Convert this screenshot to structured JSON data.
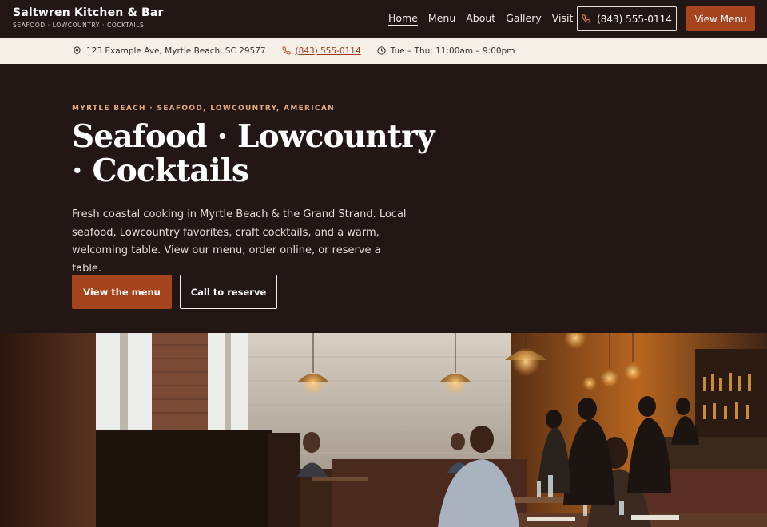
{
  "header": {
    "brand_name": "Saltwren Kitchen & Bar",
    "brand_tagline": "SEAFOOD · LOWCOUNTRY · COCKTAILS",
    "nav": [
      {
        "label": "Home",
        "active": true
      },
      {
        "label": "Menu",
        "active": false
      },
      {
        "label": "About",
        "active": false
      },
      {
        "label": "Gallery",
        "active": false
      },
      {
        "label": "Visit",
        "active": false
      }
    ],
    "phone_label": "(843) 555-0114",
    "view_menu_label": "View Menu"
  },
  "infobar": {
    "address": "123 Example Ave, Myrtle Beach, SC 29577",
    "phone": "(843) 555-0114",
    "hours": "Tue – Thu: 11:00am – 9:00pm"
  },
  "hero": {
    "eyebrow": "MYRTLE BEACH · SEAFOOD, LOWCOUNTRY, AMERICAN",
    "headline": "Seafood · Lowcountry · Cocktails",
    "subtext": "Fresh coastal cooking in Myrtle Beach & the Grand Strand. Local seafood, Lowcountry favorites, craft cocktails, and a warm, welcoming table. View our menu, order online, or reserve a table.",
    "cta_primary": "View the menu",
    "cta_secondary": "Call to reserve"
  },
  "colors": {
    "background": "#231716",
    "accent": "#a5441d",
    "infobar_bg": "#f6efe7",
    "eyebrow": "#e3a97d"
  },
  "icons": {
    "address": "map-pin-icon",
    "phone": "phone-icon",
    "hours": "clock-icon"
  }
}
